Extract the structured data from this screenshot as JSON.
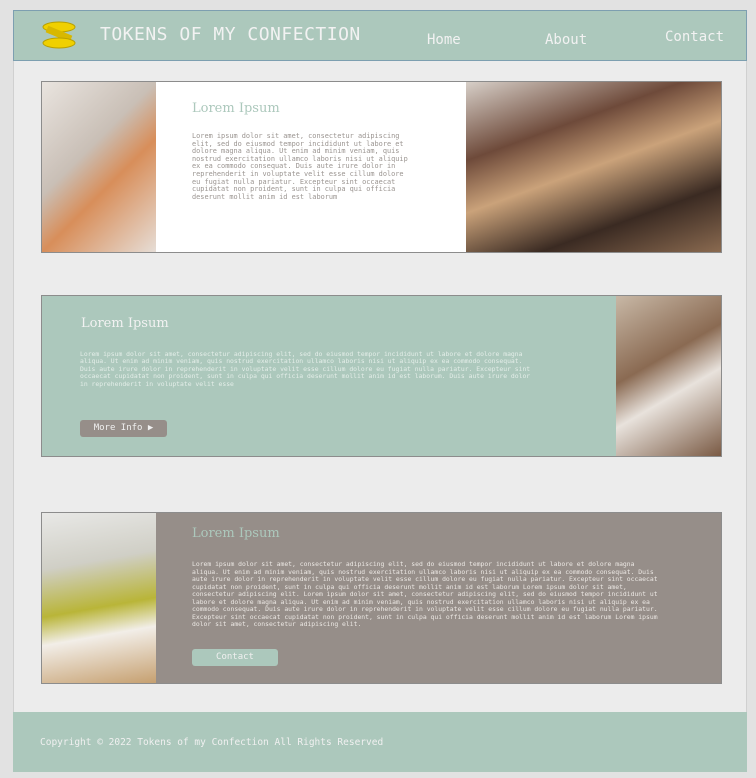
{
  "header": {
    "title": "TOKENS OF MY CONFECTION",
    "nav": [
      "Home",
      "About",
      "Contact"
    ],
    "logo_icon": "coin-stack-icon"
  },
  "colors": {
    "accent": "#acc8bc",
    "taupe": "#968e89",
    "page": "#ececec"
  },
  "section1": {
    "heading": "Lorem Ipsum",
    "body": "Lorem ipsum dolor sit amet, consectetur adipiscing\nelit, sed do eiusmod tempor incididunt ut labore et\ndolore magna aliqua. Ut enim ad minim veniam, quis\nnostrud exercitation ullamco laboris nisi ut aliquip\nex ea commodo consequat. Duis aute irure dolor in\nreprehenderit in voluptate velit esse cillum dolore\neu fugiat nulla pariatur. Excepteur sint occaecat\ncupidatat non proident, sunt in culpa qui officia\ndeserunt mollit anim id est laborum"
  },
  "section2": {
    "heading": "Lorem Ipsum",
    "body": "Lorem ipsum dolor sit amet, consectetur adipiscing elit, sed do eiusmod tempor incididunt ut labore et dolore magna\naliqua. Ut enim ad minim veniam, quis nostrud exercitation ullamco laboris nisi ut aliquip ex ea commodo consequat.\nDuis aute irure dolor in reprehenderit in voluptate velit esse cillum dolore eu fugiat nulla pariatur. Excepteur sint\noccaecat cupidatat non proident, sunt in culpa qui officia deserunt mollit anim id est laborum. Duis aute irure dolor\nin reprehenderit in voluptate velit esse",
    "button": "More Info ▶"
  },
  "section3": {
    "heading": "Lorem Ipsum",
    "body": "Lorem ipsum dolor sit amet, consectetur adipiscing elit, sed do eiusmod tempor incididunt ut labore et dolore magna\naliqua. Ut enim ad minim veniam, quis nostrud exercitation ullamco laboris nisi ut aliquip ex ea commodo consequat. Duis\naute irure dolor in reprehenderit in voluptate velit esse cillum dolore eu fugiat nulla pariatur. Excepteur sint occaecat\ncupidatat non proident, sunt in culpa qui officia deserunt mollit anim id est laborum Lorem ipsum dolor sit amet,\nconsectetur adipiscing elit. Lorem ipsum dolor sit amet, consectetur adipiscing elit, sed do eiusmod tempor incididunt ut\nlabore et dolore magna aliqua. Ut enim ad minim veniam, quis nostrud exercitation ullamco laboris nisi ut aliquip ex ea\ncommodo consequat. Duis aute irure dolor in reprehenderit in voluptate velit esse cillum dolore eu fugiat nulla pariatur.\nExcepteur sint occaecat cupidatat non proident, sunt in culpa qui officia deserunt mollit anim id est laborum Lorem ipsum\ndolor sit amet, consectetur adipiscing elit.",
    "button": "Contact"
  },
  "footer": {
    "text": "Copyright © 2022 Tokens of my Confection All Rights Reserved"
  }
}
